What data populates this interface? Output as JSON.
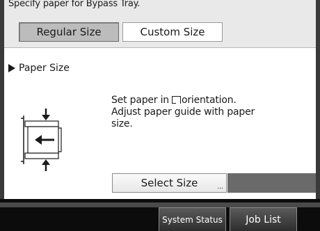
{
  "header": {
    "instruction": "Specify paper for Bypass Tray."
  },
  "tabs": {
    "regular_label": "Regular Size",
    "custom_label": "Custom Size",
    "selected": "Regular Size"
  },
  "section": {
    "heading": "Paper Size"
  },
  "message": {
    "line1_before": "Set paper in",
    "line1_after": "orientation.",
    "line2": "Adjust paper guide with paper",
    "line3": "size."
  },
  "actions": {
    "select_size_label": "Select Size",
    "select_size_dots": "..."
  },
  "footer": {
    "system_status_label": "System Status",
    "job_list_label": "Job List"
  },
  "icons": {
    "orientation": "paper-orientation-icon",
    "paper_guide": "paper-guide-icon",
    "section_marker": "triangle-right-icon"
  },
  "colors": {
    "selected_tab": "#bcbcbc",
    "footer_bg": "#0c0c0c",
    "status_area": "#6a6a6a"
  }
}
